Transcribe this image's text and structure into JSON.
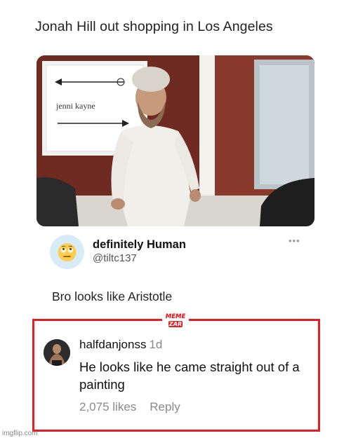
{
  "post": {
    "headline": "Jonah Hill out shopping in Los Angeles"
  },
  "photo": {
    "sign_text": "jenni kayne"
  },
  "tweet": {
    "display_name": "definitely Human",
    "handle": "@tiltc137",
    "more_icon": "more-horizontal-icon",
    "avatar_emoji": "🙄",
    "text": "Bro looks like Aristotle"
  },
  "comment": {
    "username": "halfdanjonss",
    "time": "1d",
    "text": "He looks like he came straight out of a painting",
    "likes": "2,075 likes",
    "reply": "Reply"
  },
  "watermark": {
    "line1": "MEME",
    "line2": "ZAR"
  },
  "footer": {
    "credit": "imgflip.com"
  },
  "colors": {
    "highlight_border": "#e31e24",
    "avatar_bg": "#d7ecf8",
    "muted_text": "#8a8a8a"
  }
}
